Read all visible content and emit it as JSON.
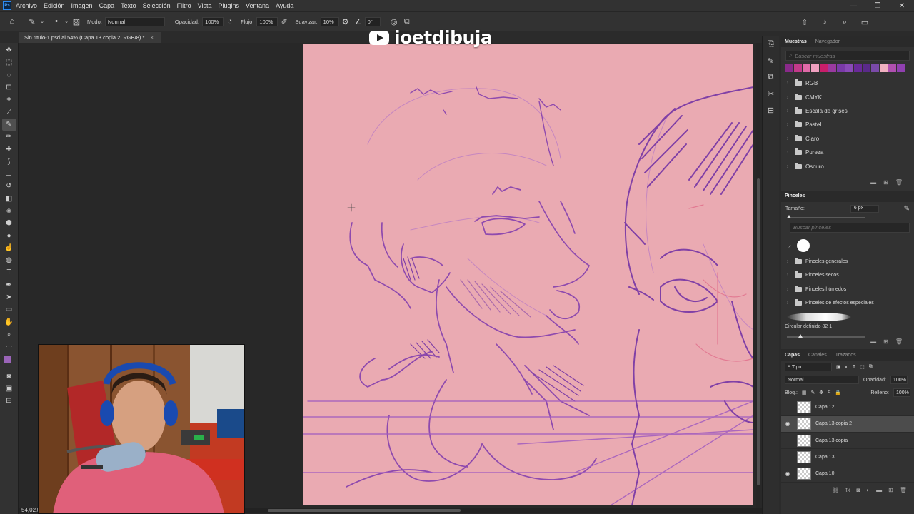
{
  "menubar": {
    "logo": "Ps",
    "items": [
      "Archivo",
      "Edición",
      "Imagen",
      "Capa",
      "Texto",
      "Selección",
      "Filtro",
      "Vista",
      "Plugins",
      "Ventana",
      "Ayuda"
    ],
    "window_controls": [
      "—",
      "❐",
      "✕"
    ]
  },
  "options": {
    "mode_label": "Modo:",
    "mode_value": "Normal",
    "opacity_label": "Opacidad:",
    "opacity_value": "100%",
    "flow_label": "Flujo:",
    "flow_value": "100%",
    "smooth_label": "Suavizar:",
    "smooth_value": "10%",
    "angle_value": "0°"
  },
  "document": {
    "tab_title": "Sin título-1.psd al 54% (Capa 13 copia 2, RGB/8) *",
    "zoom": "54,02%"
  },
  "watermark": {
    "text": "ioetdibuja"
  },
  "swatches_panel": {
    "tabs": [
      "Muestras",
      "Navegador"
    ],
    "search_placeholder": "Buscar muestras",
    "colors": [
      "#8a2a8a",
      "#c23a8a",
      "#e06aa8",
      "#f0a0c0",
      "#c81e6a",
      "#9a3aa0",
      "#7a3aa8",
      "#8a4ab8",
      "#6a2a9a",
      "#5a2a8a",
      "#7a4aa8",
      "#f0b0c0",
      "#b050b0",
      "#9040b0"
    ],
    "folders": [
      "RGB",
      "CMYK",
      "Escala de grises",
      "Pastel",
      "Claro",
      "Pureza",
      "Oscuro"
    ]
  },
  "brushes_panel": {
    "title": "Pinceles",
    "size_label": "Tamaño:",
    "size_value": "6 px",
    "search_placeholder": "Buscar pinceles",
    "folders": [
      "Pinceles generales",
      "Pinceles secos",
      "Pinceles húmedos",
      "Pinceles de efectos especiales"
    ],
    "current_brush": "Circular definido 82 1"
  },
  "layers_panel": {
    "tabs": [
      "Capas",
      "Canales",
      "Trazados"
    ],
    "filter_label": "Tipo",
    "blend_mode": "Normal",
    "opacity_label": "Opacidad:",
    "opacity_value": "100%",
    "lock_label": "Bloq.:",
    "fill_label": "Relleno:",
    "fill_value": "100%",
    "layers": [
      {
        "name": "Capa 12",
        "visible": false,
        "selected": false
      },
      {
        "name": "Capa 13 copia 2",
        "visible": true,
        "selected": true
      },
      {
        "name": "Capa 13 copia",
        "visible": false,
        "selected": false
      },
      {
        "name": "Capa 13",
        "visible": false,
        "selected": false
      },
      {
        "name": "Capa 10",
        "visible": true,
        "selected": false
      }
    ]
  }
}
